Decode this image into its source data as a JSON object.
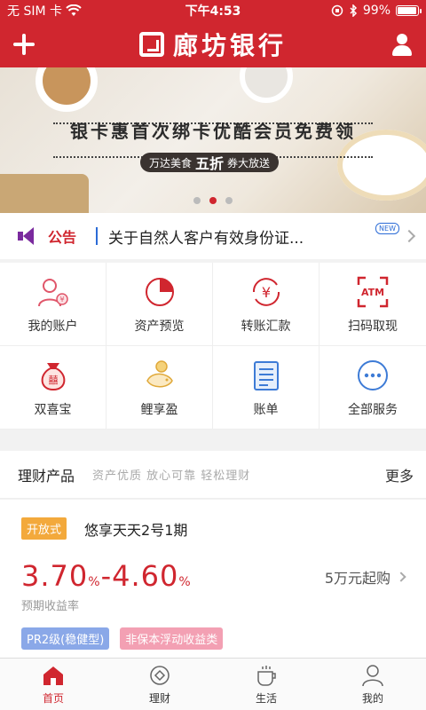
{
  "status_bar": {
    "carrier": "无 SIM 卡",
    "time": "下午4:53",
    "battery": "99%"
  },
  "header": {
    "bank_name": "廊坊银行"
  },
  "banner": {
    "title": "银卡惠首次绑卡优酷会员免费领",
    "subtitle_pre": "万达美食",
    "subtitle_big": "五折",
    "subtitle_post": "券大放送",
    "active_slide": 2,
    "slide_count": 3
  },
  "notice": {
    "label": "公告",
    "text": "关于自然人客户有效身份证...",
    "badge": "NEW"
  },
  "services": [
    {
      "label": "我的账户",
      "icon": "account-icon"
    },
    {
      "label": "资产预览",
      "icon": "pie-chart-icon"
    },
    {
      "label": "转账汇款",
      "icon": "yuan-transfer-icon"
    },
    {
      "label": "扫码取现",
      "icon": "atm-scan-icon"
    },
    {
      "label": "双喜宝",
      "icon": "money-bag-icon"
    },
    {
      "label": "鲤享盈",
      "icon": "carp-coin-icon"
    },
    {
      "label": "账单",
      "icon": "bill-icon"
    },
    {
      "label": "全部服务",
      "icon": "more-dots-icon"
    }
  ],
  "finance_section": {
    "title": "理财产品",
    "tagline": "资产优质 放心可靠 轻松理财",
    "more": "更多"
  },
  "product": {
    "badge": "开放式",
    "name": "悠享天天2号1期",
    "rate_low": "3.70",
    "rate_high": "4.60",
    "rate_unit": "%",
    "rate_label": "预期收益率",
    "min_amount": "5万元起购",
    "tags": [
      "PR2级(稳健型)",
      "非保本浮动收益类"
    ]
  },
  "tabs": [
    {
      "label": "首页",
      "icon": "home-icon",
      "active": true
    },
    {
      "label": "理财",
      "icon": "finance-icon",
      "active": false
    },
    {
      "label": "生活",
      "icon": "coffee-cup-icon",
      "active": false
    },
    {
      "label": "我的",
      "icon": "profile-icon",
      "active": false
    }
  ],
  "colors": {
    "brand_red": "#d0262f",
    "badge_orange": "#f3a93c",
    "tag_blue": "#8aa8e8",
    "tag_pink": "#f3a0b3"
  }
}
